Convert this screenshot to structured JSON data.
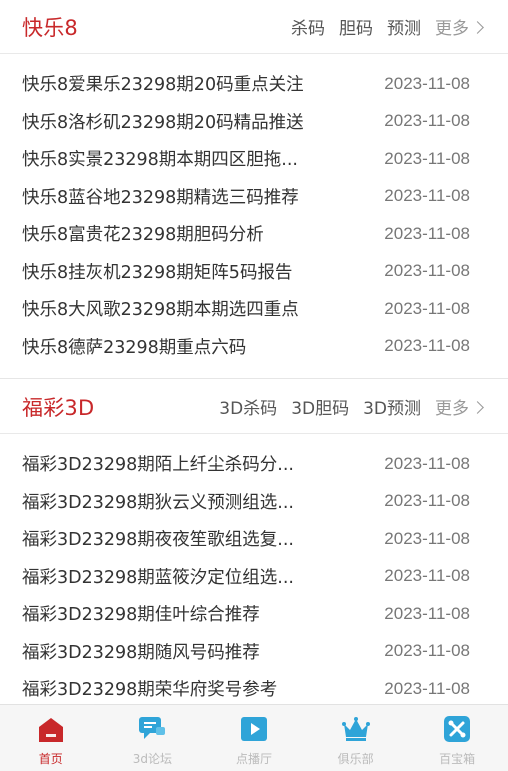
{
  "sections": [
    {
      "title": "快乐8",
      "links": [
        "杀码",
        "胆码",
        "预测"
      ],
      "more": "更多",
      "rows": [
        {
          "title": "快乐8爱果乐23298期20码重点关注",
          "date": "2023-11-08"
        },
        {
          "title": "快乐8洛杉矶23298期20码精品推送",
          "date": "2023-11-08"
        },
        {
          "title": "快乐8实景23298期本期四区胆拖...",
          "date": "2023-11-08"
        },
        {
          "title": "快乐8蓝谷地23298期精选三码推荐",
          "date": "2023-11-08"
        },
        {
          "title": "快乐8富贵花23298期胆码分析",
          "date": "2023-11-08"
        },
        {
          "title": "快乐8挂灰机23298期矩阵5码报告",
          "date": "2023-11-08"
        },
        {
          "title": "快乐8大风歌23298期本期选四重点",
          "date": "2023-11-08"
        },
        {
          "title": "快乐8德萨23298期重点六码",
          "date": "2023-11-08"
        }
      ]
    },
    {
      "title": "福彩3D",
      "links": [
        "3D杀码",
        "3D胆码",
        "3D预测"
      ],
      "more": "更多",
      "rows": [
        {
          "title": "福彩3D23298期陌上纤尘杀码分...",
          "date": "2023-11-08"
        },
        {
          "title": "福彩3D23298期狄云义预测组选...",
          "date": "2023-11-08"
        },
        {
          "title": "福彩3D23298期夜夜笙歌组选复...",
          "date": "2023-11-08"
        },
        {
          "title": "福彩3D23298期蓝筱汐定位组选...",
          "date": "2023-11-08"
        },
        {
          "title": "福彩3D23298期佳叶综合推荐",
          "date": "2023-11-08"
        },
        {
          "title": "福彩3D23298期随风号码推荐",
          "date": "2023-11-08"
        },
        {
          "title": "福彩3D23298期荣华府奖号参考",
          "date": "2023-11-08"
        }
      ]
    }
  ],
  "tabbar": [
    {
      "label": "首页",
      "icon": "home-icon",
      "active": true
    },
    {
      "label": "3d论坛",
      "icon": "forum-chat-icon",
      "active": false
    },
    {
      "label": "点播厅",
      "icon": "video-play-icon",
      "active": false
    },
    {
      "label": "俱乐部",
      "icon": "crown-icon",
      "active": false
    },
    {
      "label": "百宝箱",
      "icon": "toolbox-icon",
      "active": false
    }
  ],
  "colors": {
    "accent": "#c8282a",
    "icon_blue": "#2fa4d8",
    "tab_inactive": "#bbbbbb"
  }
}
